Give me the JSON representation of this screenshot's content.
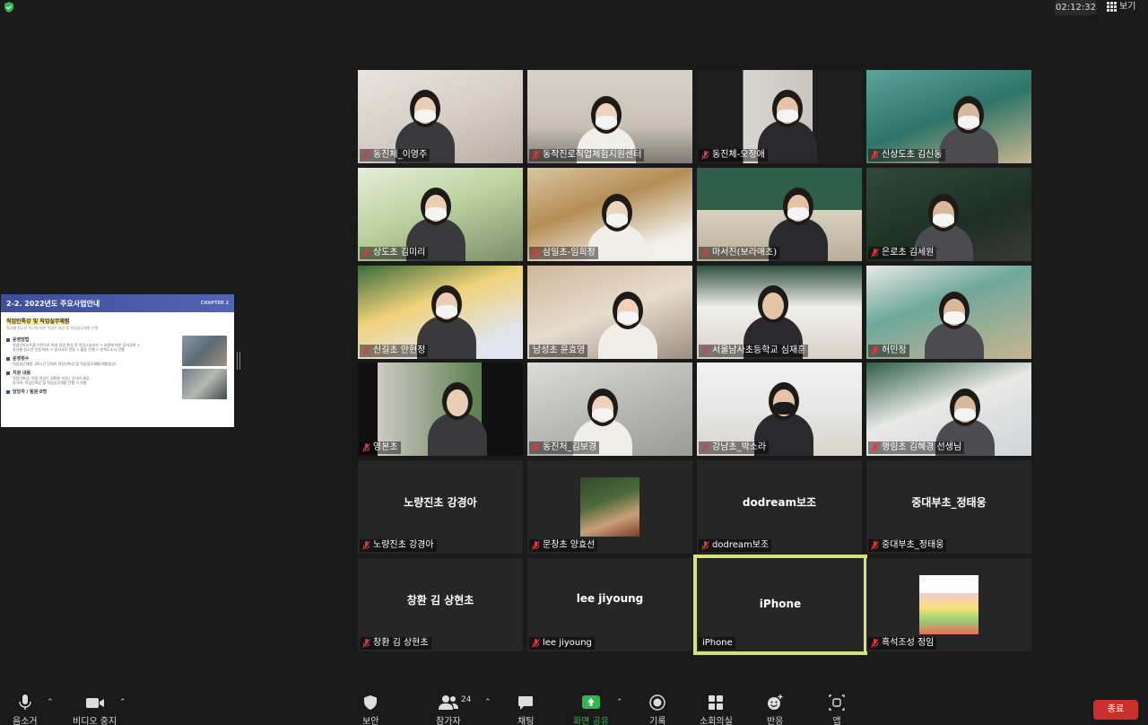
{
  "top_bar": {
    "time": "02:12:32",
    "view_label": "보기"
  },
  "share": {
    "slide_title": "2-2. 2022년도 주요사업안내",
    "chapter": "CHAPTER 2",
    "heading": "직업인특강 및 직업실무체험",
    "note": "학교별 청소년 욕구에 따른 직업인 특강 및 직업실무체험 진행",
    "sections": [
      {
        "title": "운영방법",
        "lines": [
          "직업인리스트를 기반으로 하여 일정 편성 전 직업소유조사 > 요청에 따른 강사섭외 >",
          "강사별 청소년 인원 배치 > 강사사후 전달 > 활동 진행 > 만족도조사 진행"
        ]
      },
      {
        "title": "운영횟수",
        "lines": [
          "직업실무체험: 24시간 단위의 직업인특강 및 직업실무체험(체험중심)"
        ]
      },
      {
        "title": "지원 내용",
        "lines": [
          "직업인특강: 희망 직업인 100만 지원 / 강사비 제공",
          "강사비: 직업인특강 및 직업실무체험 진행 시 지원"
        ]
      },
      {
        "title": "담당자 / 팀원 0명",
        "lines": []
      }
    ]
  },
  "participants": [
    {
      "name": "동진체_이영주",
      "muted": true
    },
    {
      "name": "동작진로직업체험지원센터",
      "muted": true
    },
    {
      "name": "동진체-오정애",
      "muted": true
    },
    {
      "name": "신상도초 김신동",
      "muted": true
    },
    {
      "name": "상도초 김미리",
      "muted": true
    },
    {
      "name": "삼일초-임희정",
      "muted": true
    },
    {
      "name": "마서진(보라매초)",
      "muted": true
    },
    {
      "name": "은로초 김세원",
      "muted": true
    },
    {
      "name": "신길초 안현정",
      "muted": true
    },
    {
      "name": "남성초 윤효영",
      "muted": false
    },
    {
      "name": "서울남사초등학교 심재훈",
      "muted": true
    },
    {
      "name": "허민정",
      "muted": true
    },
    {
      "name": "영본초",
      "muted": true
    },
    {
      "name": "동진처_김보경",
      "muted": true
    },
    {
      "name": "강남초_박소라",
      "muted": true
    },
    {
      "name": "행림초 김혜경 선생님",
      "muted": true
    },
    {
      "name": "노량진초 강경아",
      "center": "노량진초 강경아",
      "muted": true
    },
    {
      "name": "문창초 양효선",
      "muted": true
    },
    {
      "name": "dodream보조",
      "center": "dodream보조",
      "muted": true
    },
    {
      "name": "중대부초_정태웅",
      "center": "중대부초_정태웅",
      "muted": true
    },
    {
      "name": "창환 김 상현초",
      "center": "창환 김 상현초",
      "muted": true
    },
    {
      "name": "lee jiyoung",
      "center": "lee jiyoung",
      "muted": true
    },
    {
      "name": "iPhone",
      "center": "iPhone",
      "muted": false,
      "active": true
    },
    {
      "name": "흑석조성 정임",
      "muted": true
    }
  ],
  "toolbar": {
    "mute": "음소거",
    "video": "비디오 중지",
    "security": "보안",
    "participants": "참가자",
    "participants_count": "24",
    "chat": "채팅",
    "share": "화면 공유",
    "record": "기록",
    "breakout": "소회의실",
    "reactions": "반응",
    "apps": "앱",
    "end": "종료"
  },
  "colors": {
    "end": "#c9302c",
    "active_border": "#d8e27a",
    "share_green": "#2db84b"
  }
}
